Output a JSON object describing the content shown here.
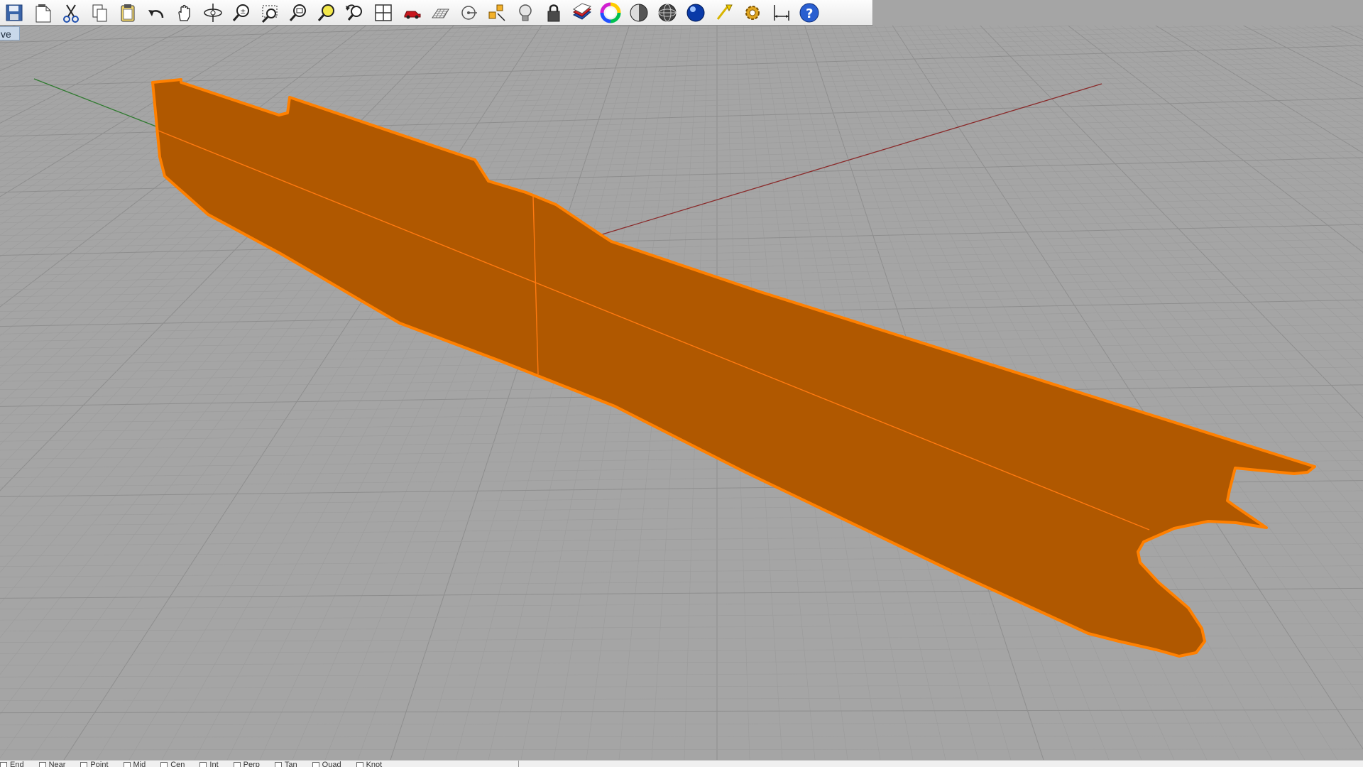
{
  "toolbar": {
    "buttons": [
      {
        "name": "save-icon",
        "tooltip": "Save"
      },
      {
        "name": "new-page-icon",
        "tooltip": "New"
      },
      {
        "name": "cut-icon",
        "tooltip": "Cut"
      },
      {
        "name": "copy-icon",
        "tooltip": "Copy"
      },
      {
        "name": "paste-icon",
        "tooltip": "Paste"
      },
      {
        "name": "undo-icon",
        "tooltip": "Undo"
      },
      {
        "name": "pan-hand-icon",
        "tooltip": "Pan"
      },
      {
        "name": "rotate-view-icon",
        "tooltip": "Rotate View"
      },
      {
        "name": "zoom-dynamic-icon",
        "tooltip": "Zoom"
      },
      {
        "name": "zoom-window-icon",
        "tooltip": "Zoom Window"
      },
      {
        "name": "zoom-extents-icon",
        "tooltip": "Zoom Extents"
      },
      {
        "name": "zoom-selected-icon",
        "tooltip": "Zoom Selected"
      },
      {
        "name": "undo-view-icon",
        "tooltip": "Undo View Change"
      },
      {
        "name": "four-viewports-icon",
        "tooltip": "4 Viewports"
      },
      {
        "name": "car-icon",
        "tooltip": "Named Views"
      },
      {
        "name": "grid-plane-icon",
        "tooltip": "Construction Plane"
      },
      {
        "name": "osnap-icon",
        "tooltip": "Object Snap"
      },
      {
        "name": "select-filter-icon",
        "tooltip": "Select"
      },
      {
        "name": "light-bulb-icon",
        "tooltip": "Show Objects"
      },
      {
        "name": "lock-icon",
        "tooltip": "Lock Objects"
      },
      {
        "name": "layers-icon",
        "tooltip": "Edit Layers"
      },
      {
        "name": "color-wheel-icon",
        "tooltip": "Object Properties"
      },
      {
        "name": "shaded-sphere-icon",
        "tooltip": "Shaded Viewport"
      },
      {
        "name": "wireframe-sphere-icon",
        "tooltip": "Wireframe Viewport"
      },
      {
        "name": "rendered-sphere-icon",
        "tooltip": "Rendered Viewport"
      },
      {
        "name": "render-icon",
        "tooltip": "Render"
      },
      {
        "name": "options-gear-icon",
        "tooltip": "Options"
      },
      {
        "name": "dimension-icon",
        "tooltip": "Dimension"
      },
      {
        "name": "help-icon",
        "tooltip": "Help"
      }
    ]
  },
  "viewport": {
    "tab_label": "ve",
    "colors": {
      "background": "#a5a5a5",
      "grid_minor": "#9b9b9b",
      "grid_major": "#8e8e8e",
      "x_axis": "#8a2a2a",
      "y_axis": "#2f7a2f",
      "surface_fill": "#b05800",
      "surface_edge": "#ff8000",
      "isocurve": "#ff7a10"
    }
  },
  "osnap": {
    "items": [
      {
        "label": "End"
      },
      {
        "label": "Near"
      },
      {
        "label": "Point"
      },
      {
        "label": "Mid"
      },
      {
        "label": "Cen"
      },
      {
        "label": "Int"
      },
      {
        "label": "Perp"
      },
      {
        "label": "Tan"
      },
      {
        "label": "Quad"
      },
      {
        "label": "Knot"
      }
    ]
  }
}
